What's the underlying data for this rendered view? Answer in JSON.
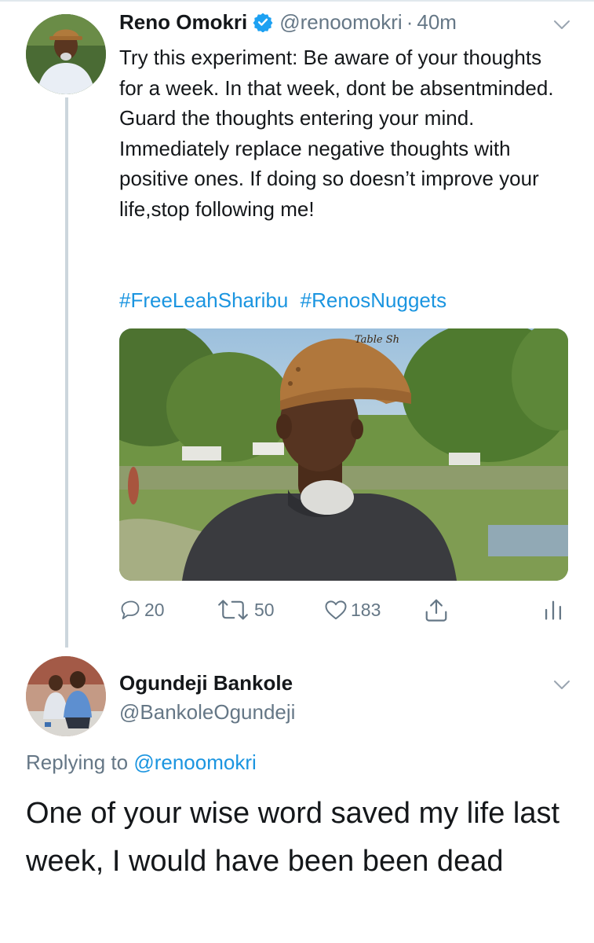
{
  "tweet": {
    "display_name": "Reno Omokri",
    "handle": "@renoomokri",
    "separator": "·",
    "time": "40m",
    "text": "Try this experiment: Be aware of your thoughts for a week. In that week, dont be absentminded. Guard the thoughts entering your mind. Immediately replace negative thoughts with positive ones. If doing so doesn’t improve your life,stop following me!",
    "hashtags": [
      "#FreeLeahSharibu",
      "#RenosNuggets"
    ],
    "cap_text": "Table Sh",
    "stats": {
      "replies": "20",
      "retweets": "50",
      "likes": "183"
    }
  },
  "reply": {
    "display_name": "Ogundeji Bankole",
    "handle": "@BankoleOgundeji",
    "replying_label": "Replying to",
    "replying_to": "@renoomokri",
    "text": "One of your wise word saved my life last week,  I would have been been dead"
  },
  "icons": [
    "verified-badge-icon",
    "chevron-down-icon",
    "reply-icon",
    "retweet-icon",
    "like-icon",
    "share-icon",
    "analytics-icon"
  ],
  "colors": {
    "link": "#1b95e0",
    "muted": "#657786",
    "text": "#14171a",
    "thread_line": "#ccd6dd"
  }
}
